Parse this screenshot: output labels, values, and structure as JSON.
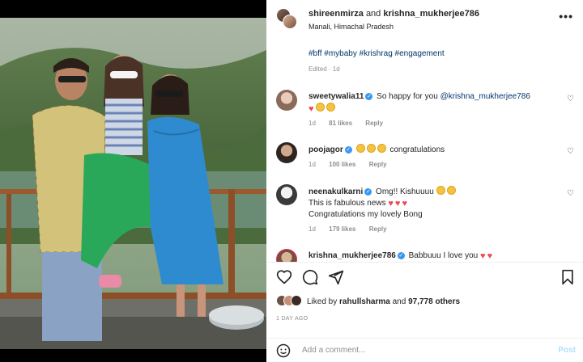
{
  "header": {
    "user1": "shireenmirza",
    "conj": "and",
    "user2": "krishna_mukherjee786",
    "location": "Manali, Himachal Pradesh",
    "more": "•••"
  },
  "caption": {
    "hashtags": "#bff #mybaby #krishrag #engagement",
    "edited": "Edited · 1d"
  },
  "comments": [
    {
      "user": "sweetywalia11",
      "text": "So happy for you ",
      "mention": "@krishna_mukherjee786",
      "time": "1d",
      "likes": "81 likes",
      "reply": "Reply"
    },
    {
      "user": "poojagor",
      "text": "congratulations",
      "time": "1d",
      "likes": "100 likes",
      "reply": "Reply"
    },
    {
      "user": "neenakulkarni",
      "text": "Omg!! Kishuuuu",
      "line2": "This is fabulous news",
      "line3": "Congratulations my lovely Bong",
      "time": "1d",
      "likes": "179 likes",
      "reply": "Reply"
    },
    {
      "user": "krishna_mukherjee786",
      "text": "Babbuuu I love you"
    }
  ],
  "likes": {
    "prefix": "Liked by",
    "user": "rahullsharma",
    "mid": "and",
    "count": "97,778 others"
  },
  "time_ago": "1 DAY AGO",
  "add_comment": {
    "placeholder": "Add a comment...",
    "post": "Post"
  },
  "colors": {
    "link": "#00376b",
    "verified": "#3897f0",
    "heart": "#ed4956",
    "muted": "#8e8e8e"
  },
  "icons": [
    "heart-icon",
    "comment-icon",
    "share-icon",
    "bookmark-icon",
    "smile-icon",
    "verified-icon",
    "more-icon"
  ]
}
